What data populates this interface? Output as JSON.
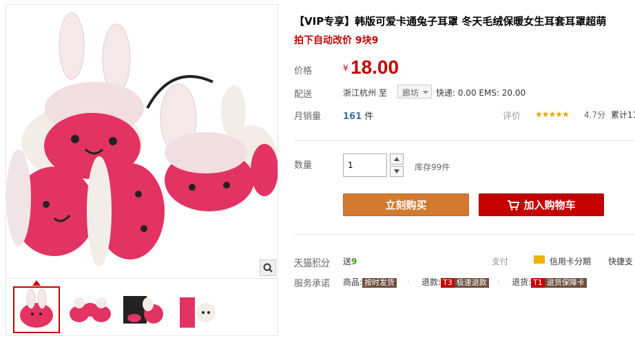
{
  "product": {
    "title": "【VIP专享】韩版可爱卡通兔子耳罩 冬天毛绒保暖女生耳套耳罩超萌",
    "promo": "拍下自动改价 9块9",
    "price_label": "价格",
    "currency": "¥",
    "price": "18.00",
    "ship_label": "配送",
    "origin": "浙江杭州",
    "to": "至",
    "destination": "廊坊",
    "fees": "快递: 0.00 EMS: 20.00",
    "sales_label": "月销量",
    "sales_count": "161",
    "sales_unit": "件",
    "rating_label": "评价",
    "stars": "★★★★★",
    "score": "4.7分",
    "accumulated": "累计11",
    "qty_label": "数量",
    "qty_value": "1",
    "stock": "库存99件",
    "buy_label": "立刻购买",
    "cart_label": "加入购物车",
    "points_label": "天猫积分",
    "points_prefix": "送",
    "points_value": "9",
    "pay_label": "支付",
    "credit_label": "信用卡分期",
    "quick_label": "快捷支",
    "service_label": "服务承诺",
    "goods_label": "商品:",
    "goods_tag": "按时发货",
    "refund_label": "退款:",
    "refund_code": "T3",
    "refund_tag": "极速退款",
    "return_label": "退货:",
    "return_code": "T1",
    "return_tag": "退货保障卡"
  },
  "colors": {
    "accent": "#c40000",
    "buy": "#d27a30",
    "star": "#e9a300"
  }
}
